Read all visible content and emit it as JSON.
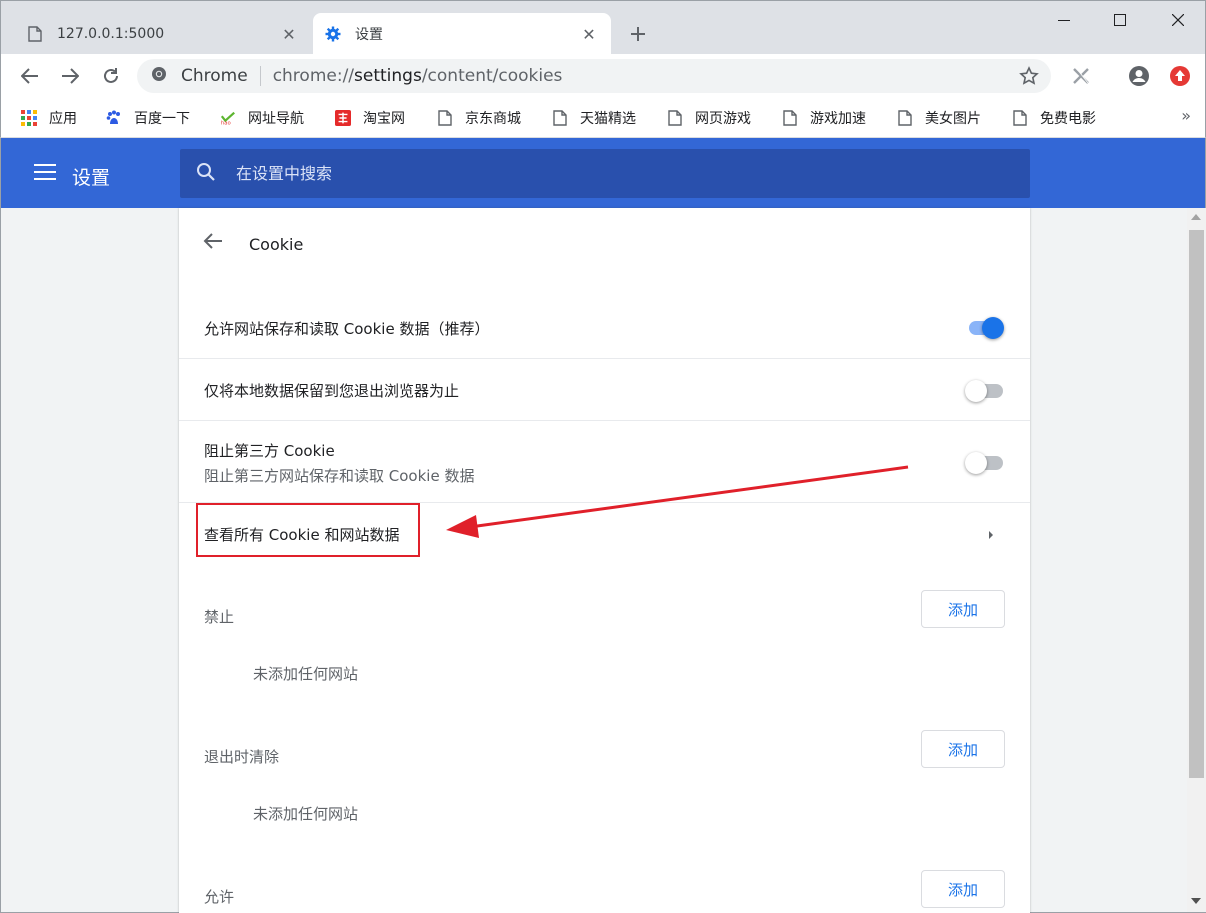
{
  "tabs": [
    {
      "title": "127.0.0.1:5000",
      "icon": "page-icon",
      "active": false
    },
    {
      "title": "设置",
      "icon": "gear-icon",
      "active": true
    }
  ],
  "new_tab_label": "+",
  "omnibox": {
    "site_label": "Chrome",
    "url_prefix": "chrome://",
    "url_dark": "settings",
    "url_suffix": "/content/cookies"
  },
  "bookmarks": [
    {
      "label": "应用",
      "icon": "apps-grid-icon"
    },
    {
      "label": "百度一下",
      "icon": "baidu-paw-icon"
    },
    {
      "label": "网址导航",
      "icon": "hao-icon"
    },
    {
      "label": "淘宝网",
      "icon": "taobao-icon"
    },
    {
      "label": "京东商城",
      "icon": "page-icon"
    },
    {
      "label": "天猫精选",
      "icon": "page-icon"
    },
    {
      "label": "网页游戏",
      "icon": "page-icon"
    },
    {
      "label": "游戏加速",
      "icon": "page-icon"
    },
    {
      "label": "美女图片",
      "icon": "page-icon"
    },
    {
      "label": "免费电影",
      "icon": "page-icon"
    }
  ],
  "bookmarks_more": "»",
  "header": {
    "title": "设置",
    "search_placeholder": "在设置中搜索"
  },
  "page": {
    "title": "Cookie",
    "rows": {
      "allow": {
        "label": "允许网站保存和读取 Cookie 数据（推荐）",
        "enabled": true
      },
      "keep_local": {
        "label": "仅将本地数据保留到您退出浏览器为止",
        "enabled": false
      },
      "block_third": {
        "label": "阻止第三方 Cookie",
        "sublabel": "阻止第三方网站保存和读取 Cookie 数据",
        "enabled": false
      },
      "see_all": {
        "label": "查看所有 Cookie 和网站数据"
      }
    },
    "sections": [
      {
        "label": "禁止",
        "add_label": "添加",
        "empty_text": "未添加任何网站"
      },
      {
        "label": "退出时清除",
        "add_label": "添加",
        "empty_text": "未添加任何网站"
      },
      {
        "label": "允许",
        "add_label": "添加"
      }
    ]
  },
  "colors": {
    "header_blue": "#3367d6",
    "toggle_on": "#1a73e8",
    "annotation_red": "#e0202a"
  }
}
